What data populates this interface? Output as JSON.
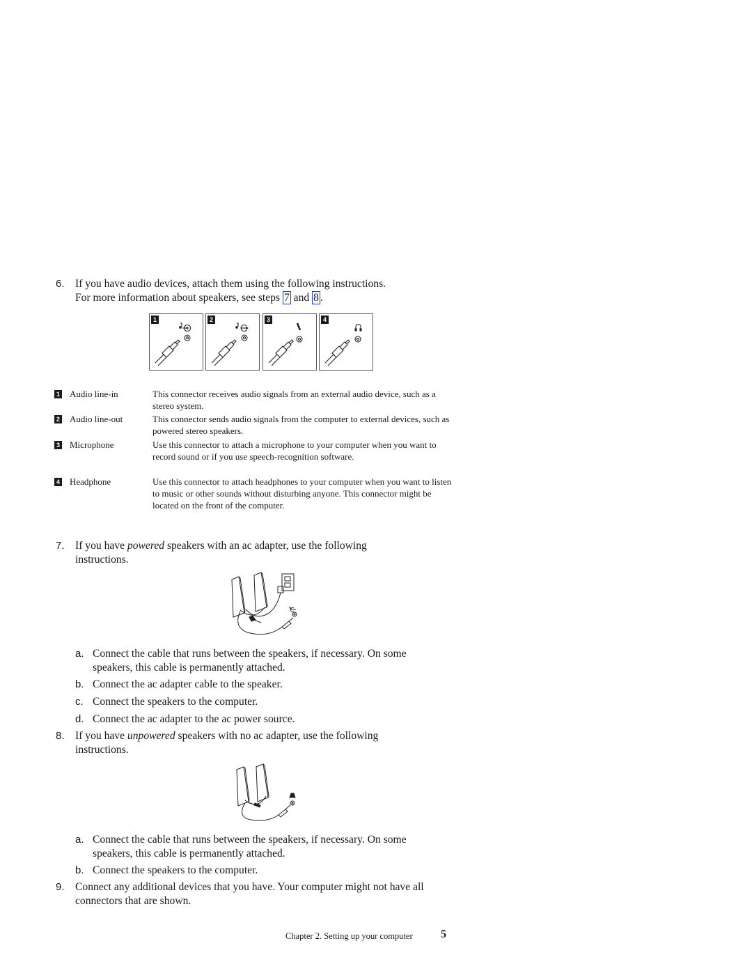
{
  "steps": [
    {
      "number": "6.",
      "text_line1": "If you have audio devices, attach them using the following instructions.",
      "text_line2_prefix": "For more information about speakers, see steps ",
      "xref1": "7",
      "text_line2_mid": " and ",
      "xref2": "8",
      "text_line2_suffix": "."
    },
    {
      "number": "7.",
      "prefix": "If you have ",
      "emphasis": "powered",
      "suffix": " speakers with an ac adapter, use the following instructions.",
      "substeps": [
        {
          "letter": "a.",
          "text": "Connect the cable that runs between the speakers, if necessary. On some speakers, this cable is permanently attached."
        },
        {
          "letter": "b.",
          "text": "Connect the ac adapter cable to the speaker."
        },
        {
          "letter": "c.",
          "text": "Connect the speakers to the computer."
        },
        {
          "letter": "d.",
          "text": "Connect the ac adapter to the ac power source."
        }
      ]
    },
    {
      "number": "8.",
      "prefix": "If you have ",
      "emphasis": "unpowered",
      "suffix": " speakers with no ac adapter, use the following instructions.",
      "substeps": [
        {
          "letter": "a.",
          "text": "Connect the cable that runs between the speakers, if necessary. On some speakers, this cable is permanently attached."
        },
        {
          "letter": "b.",
          "text": "Connect the speakers to the computer."
        }
      ]
    },
    {
      "number": "9.",
      "text": "Connect any additional devices that you have. Your computer might not have all connectors that are shown."
    }
  ],
  "connectors": [
    {
      "badge": "1",
      "name": "Audio line-in",
      "icon": "audio-line-in-icon",
      "description": "This connector receives audio signals from an external audio device, such as a stereo system."
    },
    {
      "badge": "2",
      "name": "Audio line-out",
      "icon": "audio-line-out-icon",
      "description": "This connector sends audio signals from the computer to external devices, such as powered stereo speakers."
    },
    {
      "badge": "3",
      "name": "Microphone",
      "icon": "microphone-icon",
      "description": "Use this connector to attach a microphone to your computer when you want to record sound or if you use speech-recognition software."
    },
    {
      "badge": "4",
      "name": "Headphone",
      "icon": "headphone-icon",
      "description": "Use this connector to attach headphones to your computer when you want to listen to music or other sounds without disturbing anyone. This connector might be located on the front of the computer."
    }
  ],
  "footer": {
    "chapter": "Chapter 2. Setting up your computer",
    "page_number": "5"
  },
  "colors": {
    "xref_border": "#2040e0",
    "badge_bg": "#1a1a1a"
  }
}
